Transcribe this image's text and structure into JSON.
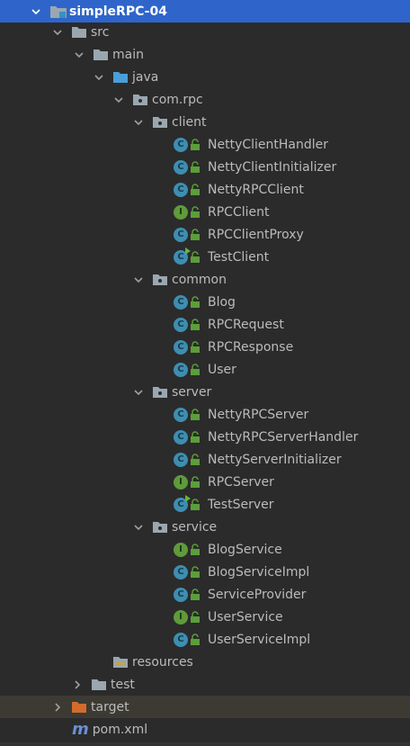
{
  "tree": {
    "project": "simpleRPC-04",
    "src": "src",
    "main": "main",
    "java": "java",
    "package": "com.rpc",
    "client": {
      "folder": "client",
      "items": [
        "NettyClientHandler",
        "NettyClientInitializer",
        "NettyRPCClient",
        "RPCClient",
        "RPCClientProxy",
        "TestClient"
      ]
    },
    "common": {
      "folder": "common",
      "items": [
        "Blog",
        "RPCRequest",
        "RPCResponse",
        "User"
      ]
    },
    "server": {
      "folder": "server",
      "items": [
        "NettyRPCServer",
        "NettyRPCServerHandler",
        "NettyServerInitializer",
        "RPCServer",
        "TestServer"
      ]
    },
    "service": {
      "folder": "service",
      "items": [
        "BlogService",
        "BlogServiceImpl",
        "ServiceProvider",
        "UserService",
        "UserServiceImpl"
      ]
    },
    "resources": "resources",
    "test": "test",
    "target": "target",
    "pom": "pom.xml",
    "maven_glyph": "m"
  },
  "icons": {
    "class_letter": "C",
    "interface_letter": "I"
  },
  "colors": {
    "selection": "#2f65ca",
    "background": "#2b2b2b",
    "class_icon": "#3d8eb1",
    "interface_icon": "#5f9a3b",
    "folder": "#9aa7b0",
    "source_folder": "#4a9fd8",
    "excluded_folder": "#d26b2e",
    "lock": "#5b9e3a"
  }
}
